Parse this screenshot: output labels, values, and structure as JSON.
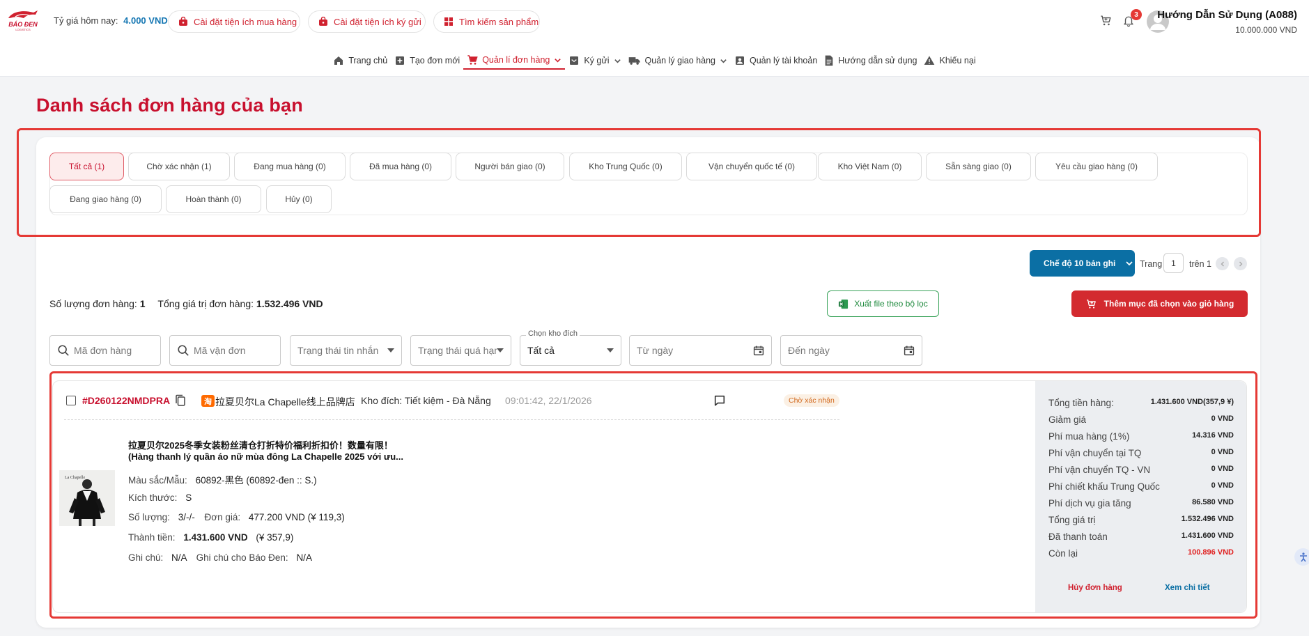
{
  "header": {
    "rate_label": "Tỷ giá hôm nay:",
    "rate_value": "4.000 VND",
    "btn_purchase_ext": "Cài đặt tiện ích mua hàng",
    "btn_deposit_ext": "Cài đặt tiện ích ký gửi",
    "btn_search_product": "Tìm kiếm sản phẩm",
    "notification_count": "3",
    "user_name": "Hướng Dẫn Sử Dụng (A088)",
    "user_balance": "10.000.000 VND",
    "accent_color": "#d0212f",
    "primary_blue": "#0b6fa4"
  },
  "nav": [
    {
      "label": "Trang chủ",
      "icon": "home-icon"
    },
    {
      "label": "Tạo đơn mới",
      "icon": "plus-square-icon"
    },
    {
      "label": "Quản lí đơn hàng",
      "icon": "cart-icon",
      "active": true,
      "dropdown": true
    },
    {
      "label": "Ký gửi",
      "icon": "inbox-icon",
      "dropdown": true
    },
    {
      "label": "Quản lý giao hàng",
      "icon": "truck-icon",
      "dropdown": true
    },
    {
      "label": "Quản lý tài khoản",
      "icon": "account-box-icon"
    },
    {
      "label": "Hướng dẫn sử dụng",
      "icon": "document-icon"
    },
    {
      "label": "Khiếu nại",
      "icon": "warning-icon"
    }
  ],
  "page_title": "Danh sách đơn hàng của bạn",
  "tabs": [
    "Tất cả (1)",
    "Chờ xác nhận (1)",
    "Đang mua hàng (0)",
    "Đã mua hàng (0)",
    "Người bán giao (0)",
    "Kho Trung Quốc (0)",
    "Vận chuyển quốc tế (0)",
    "Kho Việt Nam (0)",
    "Sẵn sàng giao (0)",
    "Yêu cầu giao hàng (0)",
    "Đang giao hàng (0)",
    "Hoàn thành (0)",
    "Hủy (0)"
  ],
  "pagination": {
    "mode_label": "Chế độ 10 bản ghi",
    "page_label": "Trang",
    "page_value": "1",
    "total_label": "trên 1"
  },
  "summary": {
    "count_label": "Số lượng đơn hàng:",
    "count_value": "1",
    "total_label": "Tổng giá trị đơn hàng:",
    "total_value": "1.532.496 VND"
  },
  "actions": {
    "export_label": "Xuất file theo bộ lọc",
    "add_cart_label": "Thêm mục đã chọn vào giỏ hàng"
  },
  "filters": {
    "order_code_placeholder": "Mã đơn hàng",
    "tracking_placeholder": "Mã vận đơn",
    "message_status_placeholder": "Trạng thái tin nhắn",
    "overdue_status_placeholder": "Trạng thái quá hạn",
    "warehouse_label": "Chọn kho đích",
    "warehouse_value": "Tất cả",
    "from_date_placeholder": "Từ ngày",
    "to_date_placeholder": "Đến ngày"
  },
  "order": {
    "id": "#D260122NMDPRA",
    "shop_icon": "淘",
    "shop_name": "拉夏贝尔La Chapelle线上品牌店",
    "warehouse": "Kho đích: Tiết kiệm - Đà Nẵng",
    "time": "09:01:42, 22/1/2026",
    "status": "Chờ xác nhận",
    "product": {
      "title_cn": "拉夏贝尔2025冬季女装粉丝清仓打折特价福利折扣价！数量有限！",
      "title_vi": "(Hàng thanh lý quần áo nữ mùa đông La Chapelle 2025 với ưu...",
      "color_label": "Màu sắc/Mẫu:",
      "color_value": "60892-黑色 (60892-đen :: S.)",
      "size_label": "Kích thước:",
      "size_value": "S",
      "qty_label": "Số lượng:",
      "qty_value": "3/-/-",
      "unit_price_label": "Đơn giá:",
      "unit_price_value": "477.200 VND (¥ 119,3)",
      "subtotal_label": "Thành tiền:",
      "subtotal_value": "1.431.600 VND",
      "subtotal_cny": "(¥ 357,9)",
      "note_label": "Ghi chú:",
      "note_value": "N/A",
      "note_bd_label": "Ghi chú cho Báo Đen:",
      "note_bd_value": "N/A",
      "image_label": "La Chapelle"
    },
    "fees": [
      {
        "label": "Tổng tiền hàng:",
        "value": "1.431.600 VND(357,9 ¥)"
      },
      {
        "label": "Giảm giá",
        "value": "0 VND"
      },
      {
        "label": "Phí mua hàng (1%)",
        "value": "14.316 VND"
      },
      {
        "label": "Phí vận chuyển tại TQ",
        "value": "0 VND"
      },
      {
        "label": "Phí vận chuyển TQ - VN",
        "value": "0 VND"
      },
      {
        "label": "Phí chiết khấu Trung Quốc",
        "value": "0 VND"
      },
      {
        "label": "Phí dịch vụ gia tăng",
        "value": "86.580 VND"
      },
      {
        "label": "Tổng giá trị",
        "value": "1.532.496 VND"
      },
      {
        "label": "Đã thanh toán",
        "value": "1.431.600 VND"
      },
      {
        "label": "Còn lại",
        "value": "100.896 VND",
        "highlight": true
      }
    ],
    "cancel_label": "Hủy đơn hàng",
    "detail_label": "Xem chi tiết"
  },
  "logo_text": "BÁO ĐEN",
  "logo_sub": "LOGISTICS"
}
